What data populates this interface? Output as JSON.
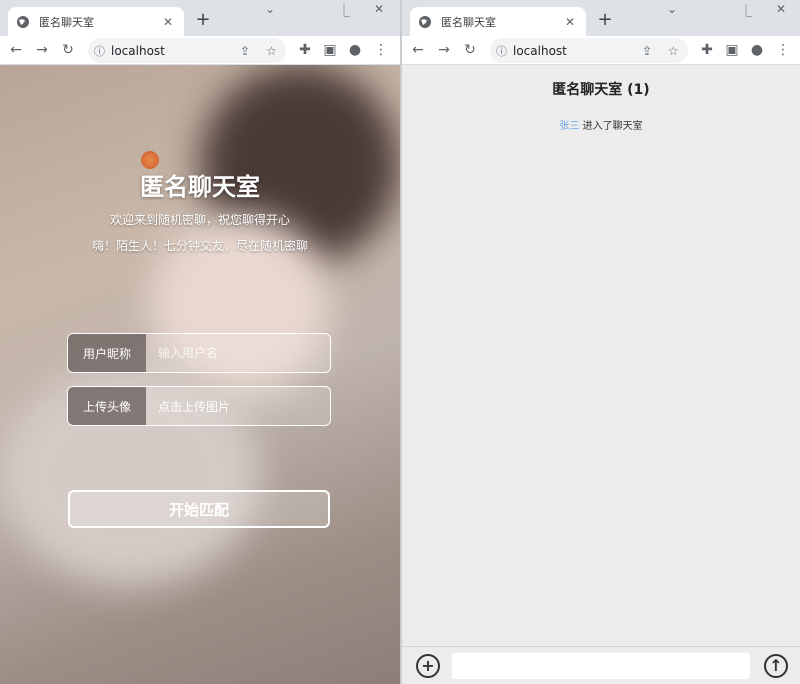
{
  "browser": {
    "tab_title": "匿名聊天室",
    "tab_close": "✕",
    "new_tab": "+",
    "url": "localhost"
  },
  "login": {
    "title": "匿名聊天室",
    "subtitle1": "欢迎来到随机密聊，祝您聊得开心",
    "subtitle2": "嗨！陌生人！七分钟交友，尽在随机密聊",
    "nickname_label": "用户昵称",
    "nickname_placeholder": "输入用户名",
    "avatar_label": "上传头像",
    "avatar_placeholder": "点击上传图片",
    "start_button": "开始匹配"
  },
  "chat": {
    "title": "匿名聊天室 (1)",
    "system_message": {
      "user": "张三",
      "text": "进入了聊天室"
    },
    "add_button": "+",
    "send_button": "↑"
  }
}
